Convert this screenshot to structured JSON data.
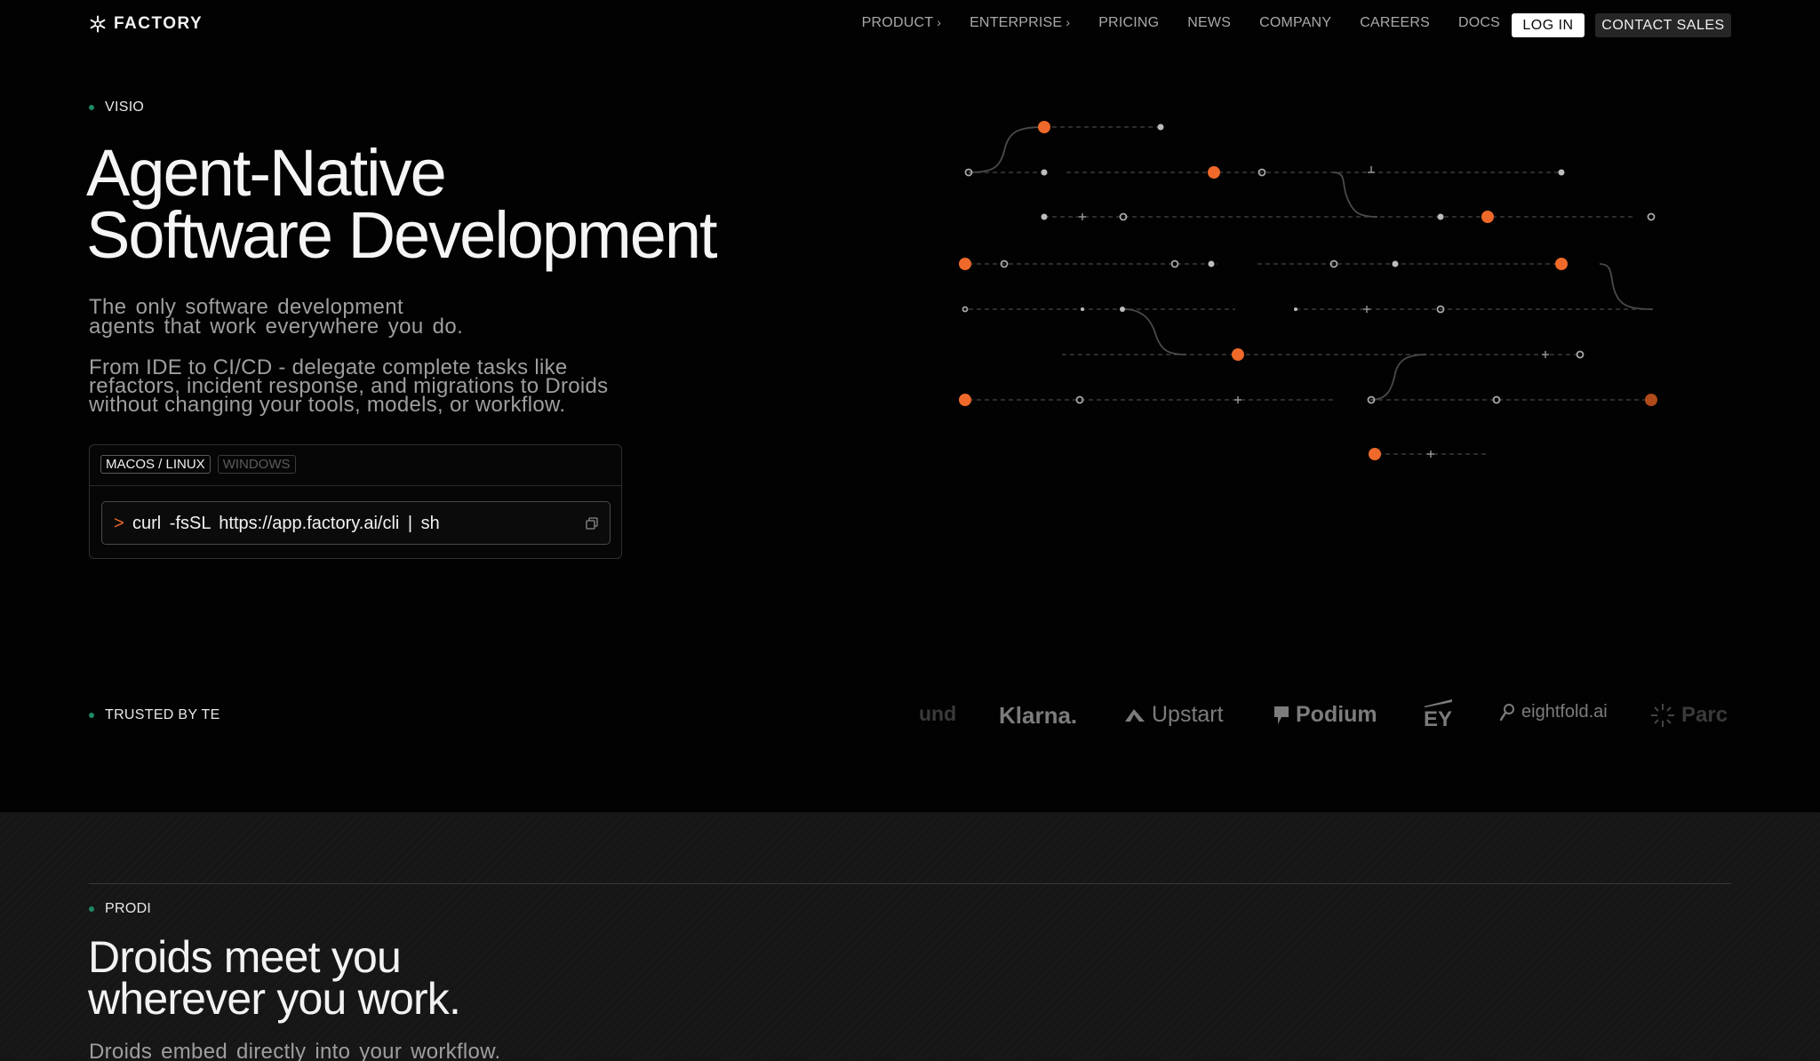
{
  "nav": {
    "brand": "FACTORY",
    "links": [
      {
        "label": "PRODUCT",
        "chevron": "›"
      },
      {
        "label": "ENTERPRISE",
        "chevron": "›"
      },
      {
        "label": "PRICING",
        "chevron": ""
      },
      {
        "label": "NEWS",
        "chevron": ""
      },
      {
        "label": "COMPANY",
        "chevron": ""
      },
      {
        "label": "CAREERS",
        "chevron": ""
      },
      {
        "label": "DOCS",
        "chevron": ""
      }
    ],
    "login": "LOG IN",
    "contact": "CONTACT SALES"
  },
  "hero": {
    "eyebrow": "VISIO",
    "title_line1": "Agent-Native",
    "title_line2": "Software Development",
    "subtitle_line1": "The only software development",
    "subtitle_line2": "agents that work everywhere you do.",
    "desc_line1": "From IDE to CI/CD - delegate complete tasks like",
    "desc_line2": "refactors, incident response, and migrations to Droids",
    "desc_line3": "without changing your tools, models, or workflow."
  },
  "install": {
    "tabs": [
      "MACOS / LINUX",
      "WINDOWS"
    ],
    "prompt": ">",
    "command": "curl -fsSL https://app.factory.ai/cli | sh"
  },
  "trusted": {
    "eyebrow": "TRUSTED BY TE",
    "logos": [
      "und",
      "Klarna.",
      "Upstart",
      "Podium",
      "EY",
      "eightfold.ai",
      "Parc"
    ]
  },
  "section2": {
    "eyebrow": "PRODI",
    "title_line1": "Droids meet you",
    "title_line2": "wherever you work.",
    "subtitle": "Droids embed directly into your workflow."
  },
  "colors": {
    "accent": "#ef6a2a",
    "eyebrow_dot": "#1e8a63",
    "background": "#020202",
    "section2_bg": "#161616"
  }
}
